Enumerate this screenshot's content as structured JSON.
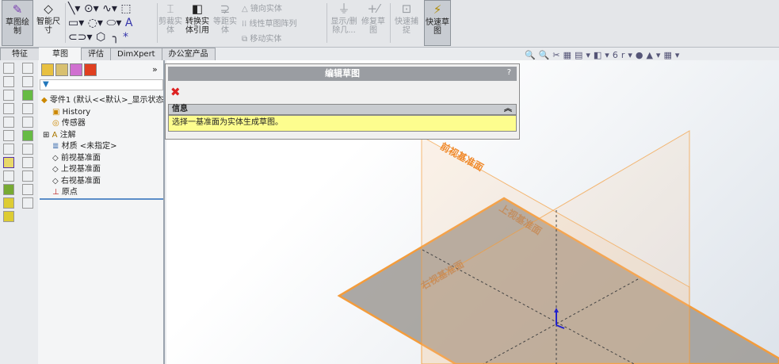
{
  "ribbon": {
    "sketch": "草图绘制",
    "smart_dim": "智能尺寸",
    "trim": "剪裁实体",
    "convert": "转换实体引用",
    "offset": "等距实体",
    "mirror": "镜向实体",
    "linear_pattern": "线性草图阵列",
    "move": "移动实体",
    "show_delete": "显示/删除几...",
    "repair": "修复草图",
    "quick_snap": "快速捕捉",
    "rapid_sketch": "快速草图"
  },
  "tabs": [
    {
      "label": "特征"
    },
    {
      "label": "草图"
    },
    {
      "label": "评估"
    },
    {
      "label": "DimXpert"
    },
    {
      "label": "办公室产品"
    }
  ],
  "tree": {
    "root": "零件1 (默认<<默认>_显示状态",
    "items": [
      "History",
      "传感器",
      "注解",
      "材质 <未指定>",
      "前视基准面",
      "上视基准面",
      "右视基准面",
      "原点"
    ]
  },
  "pm": {
    "title": "编辑草图",
    "help": "?",
    "info_header": "信息",
    "message": "选择一基准面为实体生成草图。",
    "chevron": "»"
  },
  "planes": {
    "front": "前视基准面",
    "top": "上视基准面",
    "right": "右视基准面"
  },
  "colors": {
    "plane": "#f39c3c",
    "plane_fill": "#9e9a95"
  }
}
